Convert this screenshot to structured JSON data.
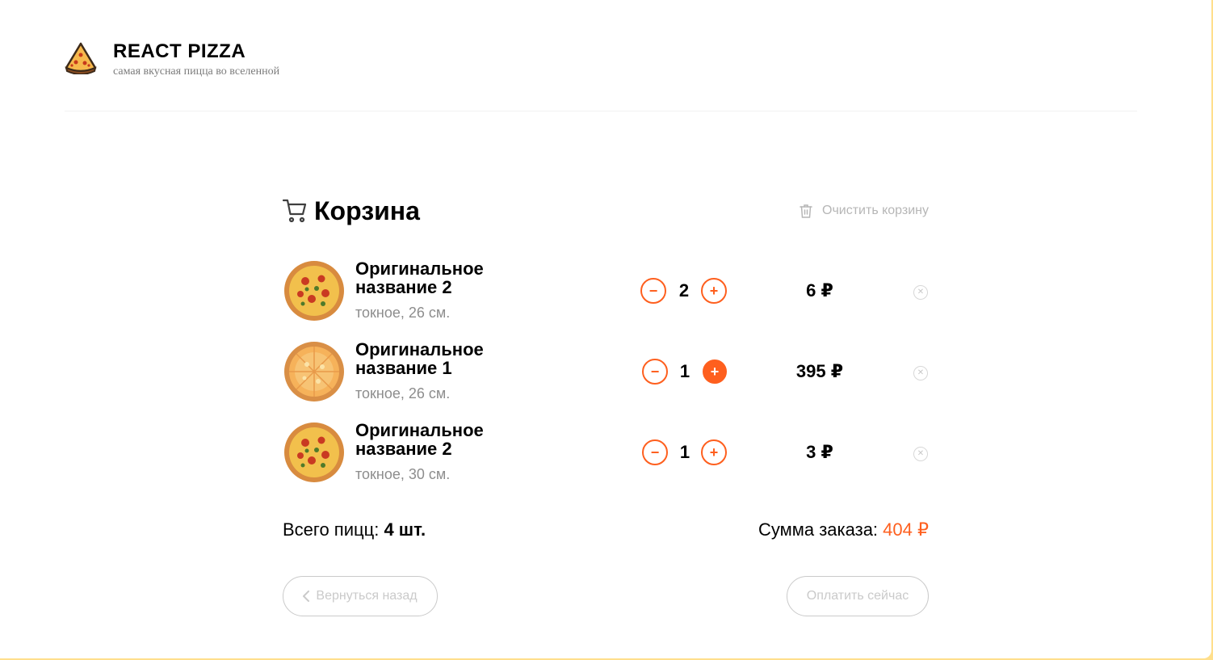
{
  "header": {
    "brand": "REACT PIZZA",
    "tagline": "самая вкусная пицца во вселенной",
    "logo_icon": "pizza-slice-icon"
  },
  "cart": {
    "title": "Корзина",
    "clear_label": "Очистить корзину",
    "items": [
      {
        "name": "Оригинальное название 2",
        "desc": "токное, 26 см.",
        "qty": "2",
        "price": "6 ₽",
        "image": "pizza-pepperoni"
      },
      {
        "name": "Оригинальное название 1",
        "desc": "токное, 26 см.",
        "qty": "1",
        "price": "395 ₽",
        "image": "pizza-cheese"
      },
      {
        "name": "Оригинальное название 2",
        "desc": "токное, 30 см.",
        "qty": "1",
        "price": "3 ₽",
        "image": "pizza-pepperoni"
      }
    ],
    "total_count_label": "Всего пицц:",
    "total_count_value": "4 шт.",
    "total_sum_label": "Сумма заказа:",
    "total_sum_value": "404 ₽",
    "back_label": "Вернуться назад",
    "pay_label": "Оплатить сейчас"
  },
  "colors": {
    "accent": "#fe5f1e",
    "background": "#ffdf8c",
    "muted": "#b6b6b6"
  }
}
